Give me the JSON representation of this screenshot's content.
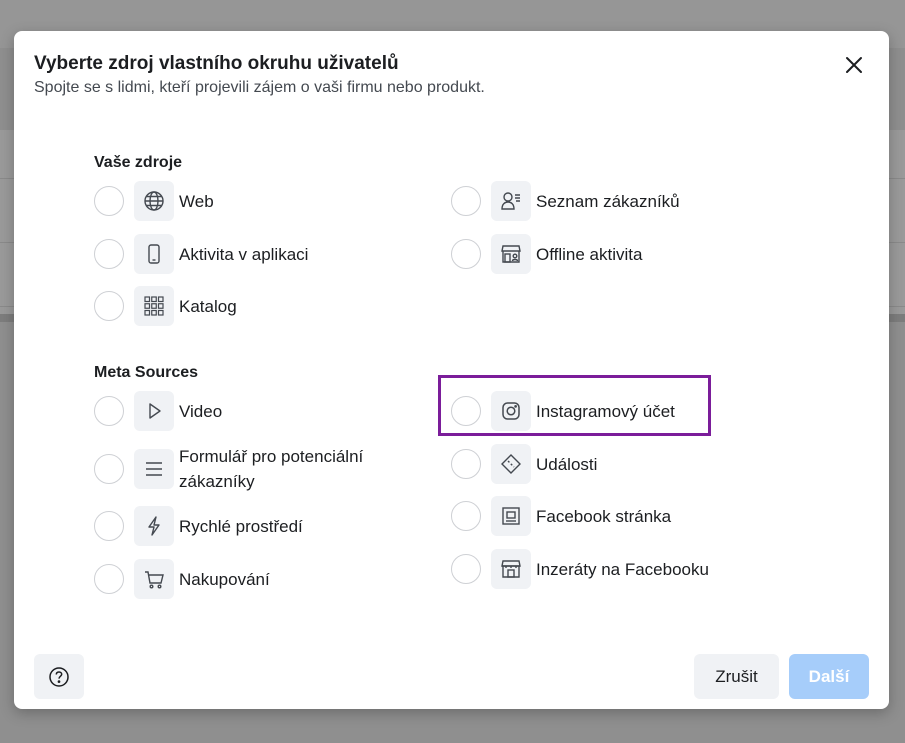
{
  "dialog": {
    "title": "Vyberte zdroj vlastního okruhu uživatelů",
    "subtitle": "Spojte se s lidmi, kteří projevili zájem o vaši firmu nebo produkt."
  },
  "your_sources": {
    "title": "Vaše zdroje",
    "options": [
      {
        "label": "Web",
        "icon": "globe-icon"
      },
      {
        "label": "Seznam zákazníků",
        "icon": "customer-list-icon"
      },
      {
        "label": "Aktivita v aplikaci",
        "icon": "mobile-app-icon"
      },
      {
        "label": "Offline aktivita",
        "icon": "store-icon"
      },
      {
        "label": "Katalog",
        "icon": "grid-icon"
      }
    ]
  },
  "meta_sources": {
    "title": "Meta Sources",
    "options": [
      {
        "label": "Video",
        "icon": "play-icon"
      },
      {
        "label": "Instagramový účet",
        "icon": "instagram-icon"
      },
      {
        "label": "Formulář pro potenciální zákazníky",
        "icon": "form-lines-icon"
      },
      {
        "label": "Události",
        "icon": "ticket-icon"
      },
      {
        "label": "Rychlé prostředí",
        "icon": "lightning-icon"
      },
      {
        "label": "Facebook stránka",
        "icon": "page-icon"
      },
      {
        "label": "Nakupování",
        "icon": "cart-icon"
      },
      {
        "label": "Inzeráty na Facebooku",
        "icon": "storefront-icon"
      }
    ]
  },
  "footer": {
    "cancel_label": "Zrušit",
    "next_label": "Další"
  },
  "colors": {
    "highlight": "#7b1d9a",
    "next_disabled": "#a6cdfa"
  }
}
